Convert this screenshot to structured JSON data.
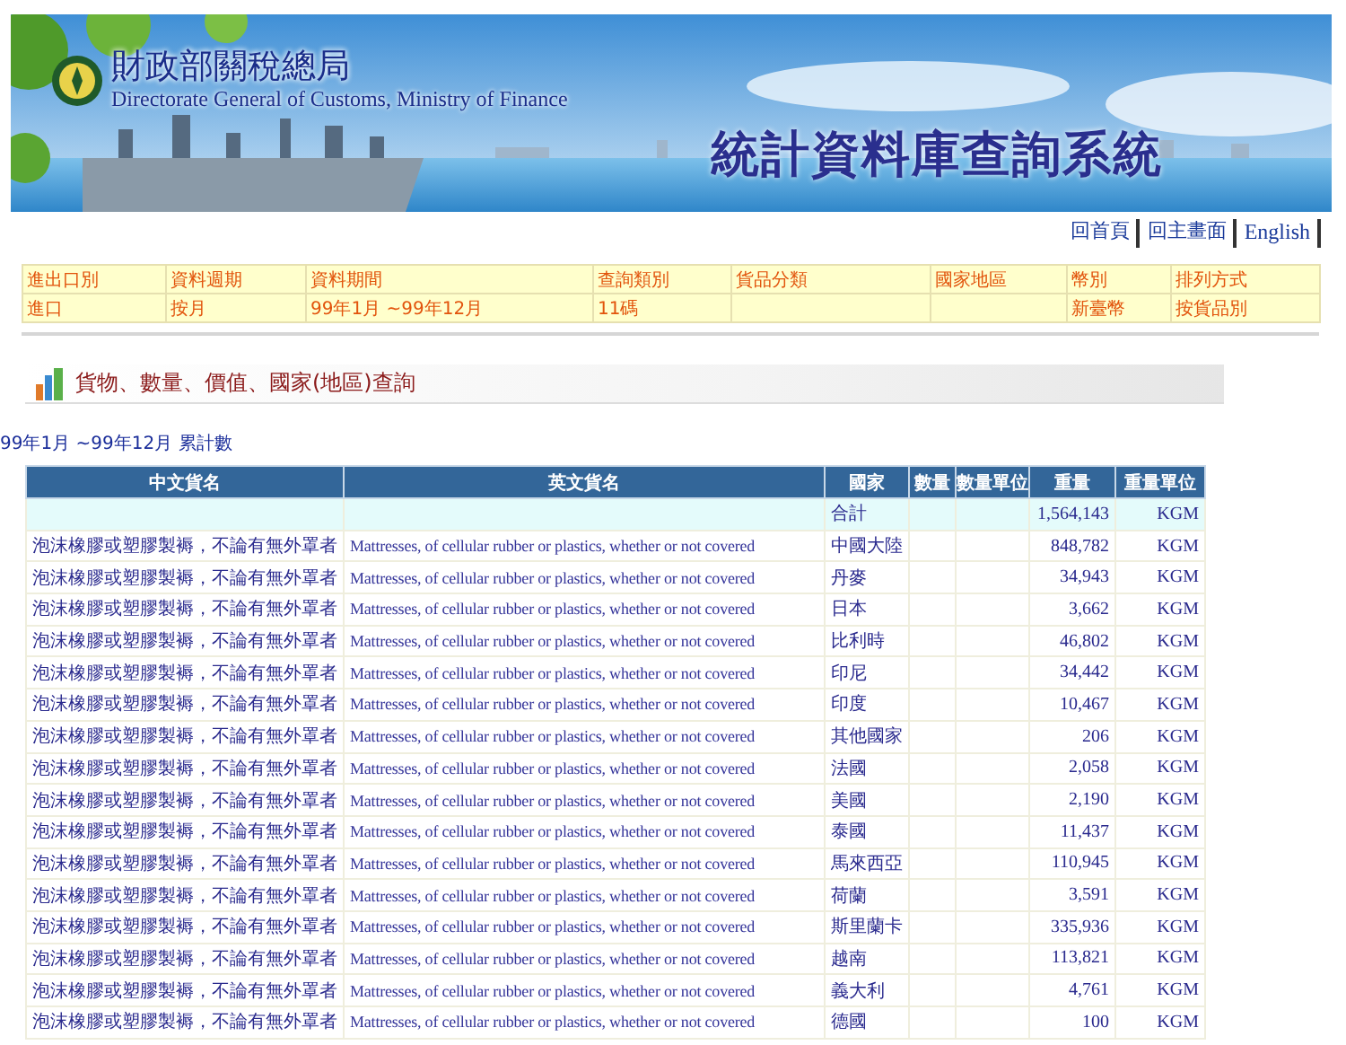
{
  "banner": {
    "agency_name": "財政部關稅總局",
    "agency_english": "Directorate General of Customs, Ministry of Finance",
    "system_title": "統計資料庫查詢系統"
  },
  "nav_links": [
    "回首頁",
    "回主畫面",
    "English"
  ],
  "query_info": [
    {
      "label": "進出口別",
      "value": "進口"
    },
    {
      "label": "資料週期",
      "value": "按月"
    },
    {
      "label": "資料期間",
      "value": "99年1月 ~99年12月"
    },
    {
      "label": "查詢類別",
      "value": "11碼"
    },
    {
      "label": "貨品分類"
    },
    {
      "label": "國家地區"
    },
    {
      "label": "幣別",
      "value": "新臺幣"
    },
    {
      "label": "排列方式",
      "value": "按貨品別"
    }
  ],
  "section_title": "貨物、數量、價值、國家(地區)查詢",
  "period_note": "99年1月 ~99年12月 累計數",
  "table": {
    "columns": [
      "中文貨名",
      "英文貨名",
      "國家",
      "數量",
      "數量單位",
      "重量",
      "重量單位"
    ],
    "total_row": {
      "country": "合計",
      "weight": "1,564,143",
      "weight_unit": "KGM"
    },
    "rows": [
      {
        "chinese_name": "泡沫橡膠或塑膠製褥，不論有無外罩者",
        "english_name": "Mattresses, of cellular rubber or plastics, whether or not covered",
        "country": "中國大陸",
        "weight": "848,782",
        "weight_unit": "KGM"
      },
      {
        "chinese_name": "泡沫橡膠或塑膠製褥，不論有無外罩者",
        "english_name": "Mattresses, of cellular rubber or plastics, whether or not covered",
        "country": "丹麥",
        "weight": "34,943",
        "weight_unit": "KGM"
      },
      {
        "chinese_name": "泡沫橡膠或塑膠製褥，不論有無外罩者",
        "english_name": "Mattresses, of cellular rubber or plastics, whether or not covered",
        "country": "日本",
        "weight": "3,662",
        "weight_unit": "KGM"
      },
      {
        "chinese_name": "泡沫橡膠或塑膠製褥，不論有無外罩者",
        "english_name": "Mattresses, of cellular rubber or plastics, whether or not covered",
        "country": "比利時",
        "weight": "46,802",
        "weight_unit": "KGM"
      },
      {
        "chinese_name": "泡沫橡膠或塑膠製褥，不論有無外罩者",
        "english_name": "Mattresses, of cellular rubber or plastics, whether or not covered",
        "country": "印尼",
        "weight": "34,442",
        "weight_unit": "KGM"
      },
      {
        "chinese_name": "泡沫橡膠或塑膠製褥，不論有無外罩者",
        "english_name": "Mattresses, of cellular rubber or plastics, whether or not covered",
        "country": "印度",
        "weight": "10,467",
        "weight_unit": "KGM"
      },
      {
        "chinese_name": "泡沫橡膠或塑膠製褥，不論有無外罩者",
        "english_name": "Mattresses, of cellular rubber or plastics, whether or not covered",
        "country": "其他國家",
        "weight": "206",
        "weight_unit": "KGM"
      },
      {
        "chinese_name": "泡沫橡膠或塑膠製褥，不論有無外罩者",
        "english_name": "Mattresses, of cellular rubber or plastics, whether or not covered",
        "country": "法國",
        "weight": "2,058",
        "weight_unit": "KGM"
      },
      {
        "chinese_name": "泡沫橡膠或塑膠製褥，不論有無外罩者",
        "english_name": "Mattresses, of cellular rubber or plastics, whether or not covered",
        "country": "美國",
        "weight": "2,190",
        "weight_unit": "KGM"
      },
      {
        "chinese_name": "泡沫橡膠或塑膠製褥，不論有無外罩者",
        "english_name": "Mattresses, of cellular rubber or plastics, whether or not covered",
        "country": "泰國",
        "weight": "11,437",
        "weight_unit": "KGM"
      },
      {
        "chinese_name": "泡沫橡膠或塑膠製褥，不論有無外罩者",
        "english_name": "Mattresses, of cellular rubber or plastics, whether or not covered",
        "country": "馬來西亞",
        "weight": "110,945",
        "weight_unit": "KGM"
      },
      {
        "chinese_name": "泡沫橡膠或塑膠製褥，不論有無外罩者",
        "english_name": "Mattresses, of cellular rubber or plastics, whether or not covered",
        "country": "荷蘭",
        "weight": "3,591",
        "weight_unit": "KGM"
      },
      {
        "chinese_name": "泡沫橡膠或塑膠製褥，不論有無外罩者",
        "english_name": "Mattresses, of cellular rubber or plastics, whether or not covered",
        "country": "斯里蘭卡",
        "weight": "335,936",
        "weight_unit": "KGM"
      },
      {
        "chinese_name": "泡沫橡膠或塑膠製褥，不論有無外罩者",
        "english_name": "Mattresses, of cellular rubber or plastics, whether or not covered",
        "country": "越南",
        "weight": "113,821",
        "weight_unit": "KGM"
      },
      {
        "chinese_name": "泡沫橡膠或塑膠製褥，不論有無外罩者",
        "english_name": "Mattresses, of cellular rubber or plastics, whether or not covered",
        "country": "義大利",
        "weight": "4,761",
        "weight_unit": "KGM"
      },
      {
        "chinese_name": "泡沫橡膠或塑膠製褥，不論有無外罩者",
        "english_name": "Mattresses, of cellular rubber or plastics, whether or not covered",
        "country": "德國",
        "weight": "100",
        "weight_unit": "KGM"
      }
    ]
  }
}
